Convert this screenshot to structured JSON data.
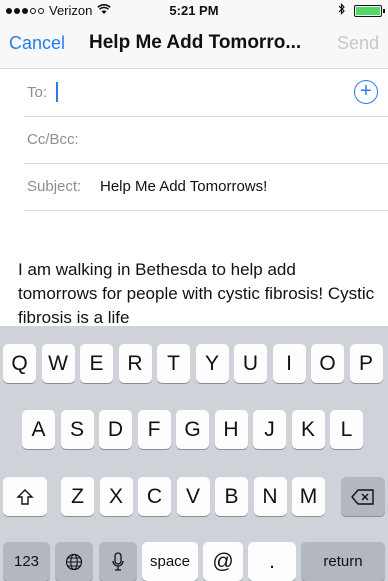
{
  "status_bar": {
    "carrier": "Verizon",
    "time": "5:21 PM",
    "signal_icon": "signal-dots-icon",
    "wifi_icon": "wifi-icon",
    "bluetooth_icon": "bluetooth-icon",
    "battery_icon": "battery-charging-icon"
  },
  "nav": {
    "cancel_label": "Cancel",
    "title": "Help Me Add Tomorro...",
    "send_label": "Send"
  },
  "form": {
    "to_label": "To:",
    "to_value": "",
    "cc_label": "Cc/Bcc:",
    "subject_label": "Subject:",
    "subject_value": "Help Me Add Tomorrows!",
    "body_text": "I am walking in Bethesda to help add tomorrows for people with cystic fibrosis! Cystic fibrosis is a life"
  },
  "keyboard": {
    "row1": [
      "Q",
      "W",
      "E",
      "R",
      "T",
      "Y",
      "U",
      "I",
      "O",
      "P"
    ],
    "row2": [
      "A",
      "S",
      "D",
      "F",
      "G",
      "H",
      "J",
      "K",
      "L"
    ],
    "row3": [
      "Z",
      "X",
      "C",
      "V",
      "B",
      "N",
      "M"
    ],
    "numbers_label": "123",
    "space_label": "space",
    "at_label": "@",
    "period_label": ".",
    "return_label": "return"
  },
  "colors": {
    "accent": "#2a7bf3",
    "send_disabled": "#c7c7cc",
    "keyboard_bg": "#cfd3d9"
  }
}
